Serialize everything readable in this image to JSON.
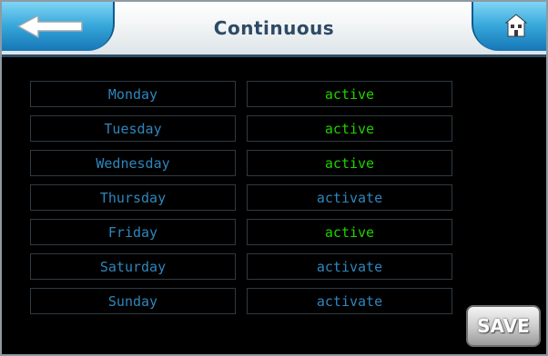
{
  "header": {
    "title": "Continuous",
    "back_icon": "arrow-left-icon",
    "home_icon": "home-icon"
  },
  "days": [
    {
      "day": "Monday",
      "status": "active",
      "state": "active"
    },
    {
      "day": "Tuesday",
      "status": "active",
      "state": "active"
    },
    {
      "day": "Wednesday",
      "status": "active",
      "state": "active"
    },
    {
      "day": "Thursday",
      "status": "activate",
      "state": "inactive"
    },
    {
      "day": "Friday",
      "status": "active",
      "state": "active"
    },
    {
      "day": "Saturday",
      "status": "activate",
      "state": "inactive"
    },
    {
      "day": "Sunday",
      "status": "activate",
      "state": "inactive"
    }
  ],
  "save": {
    "label": "SAVE"
  },
  "colors": {
    "accent": "#35a6da",
    "active_text": "#22d000",
    "inactive_text": "#2e86bd",
    "title_text": "#2d4a66"
  }
}
